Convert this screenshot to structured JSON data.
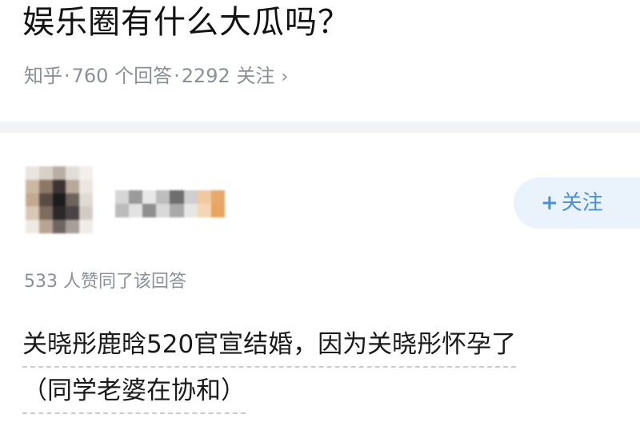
{
  "question": {
    "title": "娱乐圈有什么大瓜吗？",
    "source": "知乎",
    "sep1": "·",
    "answers_count": "760 个回答",
    "sep2": "·",
    "followers_count": "2292 关注",
    "chevron": "›"
  },
  "author": {
    "follow_label": "关注",
    "follow_plus": "+"
  },
  "answer": {
    "upvote_text": "533 人赞同了该回答",
    "line1": "关晓彤鹿晗520官宣结婚，因为关晓彤怀孕了",
    "line2": "（同学老婆在协和）"
  },
  "colors": {
    "accent": "#4a90d9",
    "follow_bg": "#eaf3fb",
    "meta_gray": "#8a8f99"
  }
}
